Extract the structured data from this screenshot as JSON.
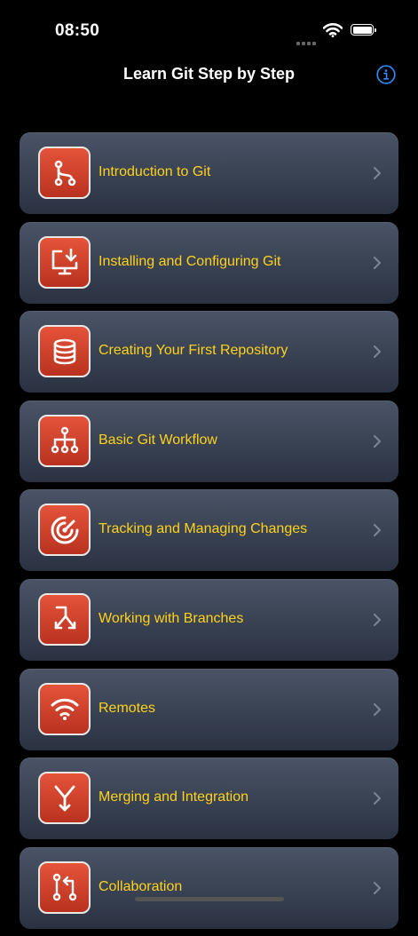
{
  "status_bar": {
    "time": "08:50"
  },
  "nav": {
    "title": "Learn Git Step by Step",
    "info_icon": "info-circle-icon"
  },
  "accent_colors": {
    "label": "#ffd21a",
    "icon_tile": "#d8442b",
    "info": "#2f8cff"
  },
  "lessons": [
    {
      "label": "Introduction to Git",
      "icon": "git-branch-icon"
    },
    {
      "label": "Installing and Configuring Git",
      "icon": "monitor-download-icon"
    },
    {
      "label": "Creating Your First Repository",
      "icon": "database-icon"
    },
    {
      "label": "Basic Git Workflow",
      "icon": "sitemap-icon"
    },
    {
      "label": "Tracking and Managing Changes",
      "icon": "target-icon"
    },
    {
      "label": "Working with Branches",
      "icon": "split-arrows-icon"
    },
    {
      "label": "Remotes",
      "icon": "wifi-icon"
    },
    {
      "label": "Merging and Integration",
      "icon": "merge-icon"
    },
    {
      "label": "Collaboration",
      "icon": "pull-request-icon"
    }
  ]
}
